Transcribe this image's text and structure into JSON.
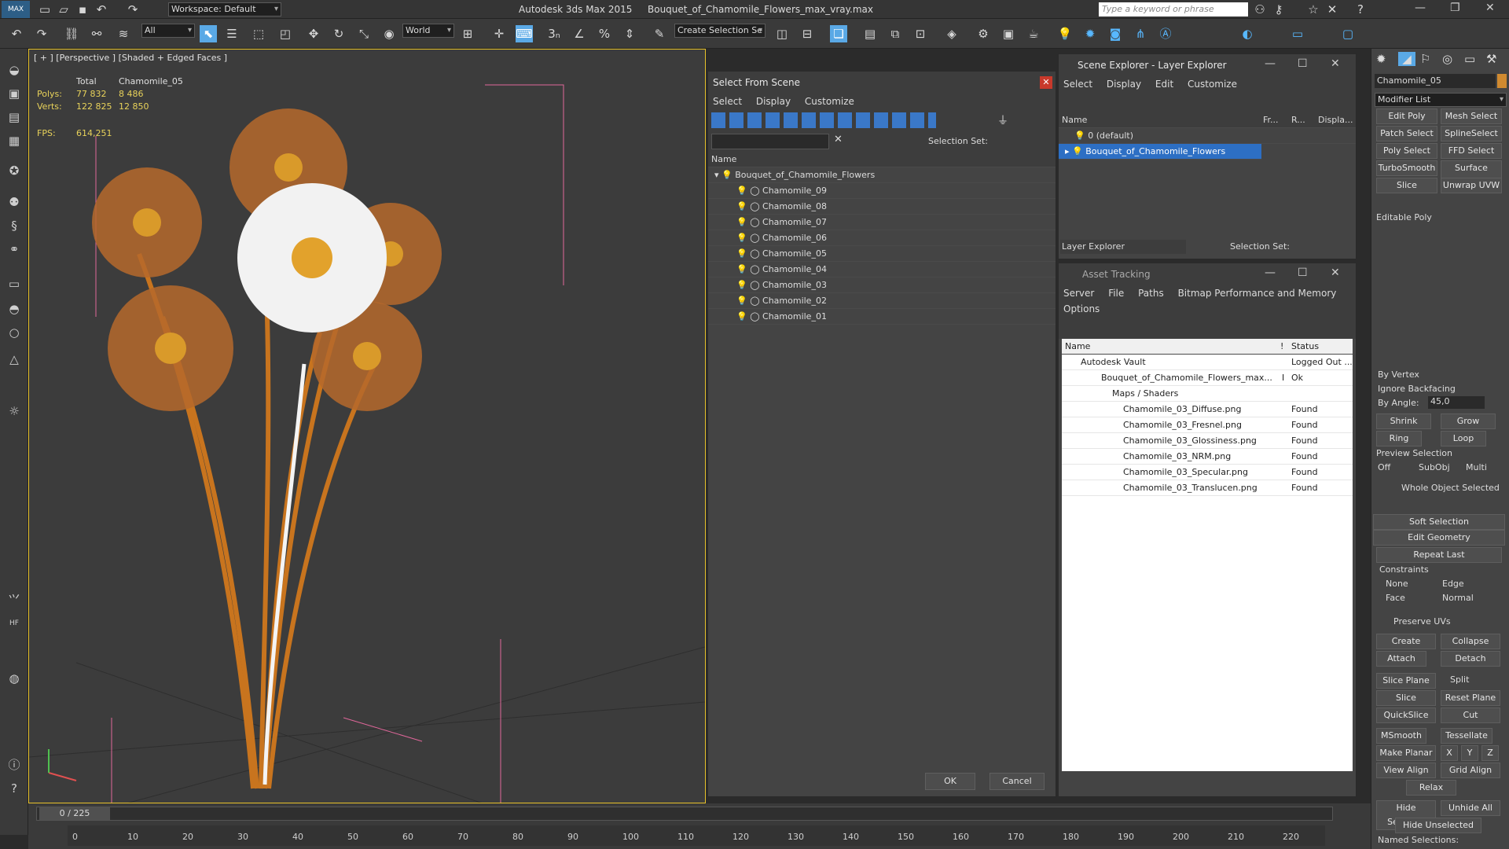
{
  "app": {
    "title": "Autodesk 3ds Max  2015",
    "file": "Bouquet_of_Chamomile_Flowers_max_vray.max",
    "workspace": "Workspace: Default",
    "search_placeholder": "Type a keyword or phrase",
    "logo": "MAX"
  },
  "toolbar": {
    "selection_filter": "All",
    "ref_coord": "World",
    "named_selection": "Create Selection Se"
  },
  "viewport": {
    "label": "[ + ] [Perspective ] [Shaded + Edged Faces ]",
    "stats": {
      "total": "Total",
      "object": "Chamomile_05",
      "polys_label": "Polys:",
      "polys_total": "77 832",
      "polys_obj": "8 486",
      "verts_label": "Verts:",
      "verts_total": "122 825",
      "verts_obj": "12 850",
      "fps_label": "FPS:",
      "fps": "614,251"
    }
  },
  "select_from_scene": {
    "title": "Select From Scene",
    "menu": [
      "Select",
      "Display",
      "Customize"
    ],
    "selection_set_label": "Selection Set:",
    "col_name": "Name",
    "root": "Bouquet_of_Chamomile_Flowers",
    "items": [
      "Chamomile_09",
      "Chamomile_08",
      "Chamomile_07",
      "Chamomile_06",
      "Chamomile_05",
      "Chamomile_04",
      "Chamomile_03",
      "Chamomile_02",
      "Chamomile_01"
    ],
    "ok": "OK",
    "cancel": "Cancel"
  },
  "scene_explorer": {
    "title": "Scene Explorer - Layer Explorer",
    "menu": [
      "Select",
      "Display",
      "Edit",
      "Customize"
    ],
    "cols": [
      "Name",
      "Fr...",
      "R...",
      "Displa..."
    ],
    "layers": [
      "0 (default)",
      "Bouquet_of_Chamomile_Flowers"
    ],
    "footer_combo": "Layer Explorer",
    "selection_set_label": "Selection Set:"
  },
  "asset_tracking": {
    "title": "Asset Tracking",
    "menu": [
      "Server",
      "File",
      "Paths",
      "Bitmap Performance and Memory"
    ],
    "menu2": "Options",
    "cols": [
      "Name",
      "!",
      "Status"
    ],
    "rows": [
      {
        "name": "Autodesk Vault",
        "flag": "",
        "status": "Logged Out ..."
      },
      {
        "name": "Bouquet_of_Chamomile_Flowers_max...",
        "flag": "I",
        "status": "Ok"
      },
      {
        "name": "Maps / Shaders",
        "flag": "",
        "status": ""
      },
      {
        "name": "Chamomile_03_Diffuse.png",
        "flag": "",
        "status": "Found"
      },
      {
        "name": "Chamomile_03_Fresnel.png",
        "flag": "",
        "status": "Found"
      },
      {
        "name": "Chamomile_03_Glossiness.png",
        "flag": "",
        "status": "Found"
      },
      {
        "name": "Chamomile_03_NRM.png",
        "flag": "",
        "status": "Found"
      },
      {
        "name": "Chamomile_03_Specular.png",
        "flag": "",
        "status": "Found"
      },
      {
        "name": "Chamomile_03_Translucen.png",
        "flag": "",
        "status": "Found"
      }
    ]
  },
  "command_panel": {
    "object_name": "Chamomile_05",
    "modifier_list": "Modifier List",
    "mods": [
      "Edit Poly",
      "Mesh Select",
      "Patch Select",
      "SplineSelect",
      "Poly Select",
      "FFD Select",
      "TurboSmooth",
      "Surface Select",
      "Slice",
      "Unwrap UVW"
    ],
    "stack_item": "Editable Poly",
    "by_vertex": "By Vertex",
    "ignore_backfacing": "Ignore Backfacing",
    "by_angle": "By Angle:",
    "angle_value": "45,0",
    "shrink": "Shrink",
    "grow": "Grow",
    "ring": "Ring",
    "loop": "Loop",
    "preview_selection": "Preview Selection",
    "off": "Off",
    "subobj": "SubObj",
    "multi": "Multi",
    "whole_object": "Whole Object Selected",
    "soft_selection": "Soft Selection",
    "edit_geometry": "Edit Geometry",
    "repeat_last": "Repeat Last",
    "constraints": "Constraints",
    "none": "None",
    "edge": "Edge",
    "face": "Face",
    "normal": "Normal",
    "preserve_uvs": "Preserve UVs",
    "create": "Create",
    "collapse": "Collapse",
    "attach": "Attach",
    "detach": "Detach",
    "slice_plane": "Slice Plane",
    "split": "Split",
    "slice": "Slice",
    "reset_plane": "Reset Plane",
    "quickslice": "QuickSlice",
    "cut": "Cut",
    "msmooth": "MSmooth",
    "tessellate": "Tessellate",
    "make_planar": "Make Planar",
    "x": "X",
    "y": "Y",
    "z": "Z",
    "view_align": "View Align",
    "grid_align": "Grid Align",
    "relax": "Relax",
    "hide_selected": "Hide Selected",
    "unhide_all": "Unhide All",
    "hide_unselected": "Hide Unselected",
    "named_selections": "Named Selections:"
  },
  "timeline": {
    "frame": "0 / 225",
    "ticks": [
      "0",
      "10",
      "20",
      "30",
      "40",
      "50",
      "60",
      "70",
      "80",
      "90",
      "100",
      "110",
      "120",
      "130",
      "140",
      "150",
      "160",
      "170",
      "180",
      "190",
      "200",
      "210",
      "220"
    ]
  },
  "colors": {
    "accent": "#5aa9e6",
    "viewport_border": "#e8c22a",
    "flower": "#c8741e"
  }
}
